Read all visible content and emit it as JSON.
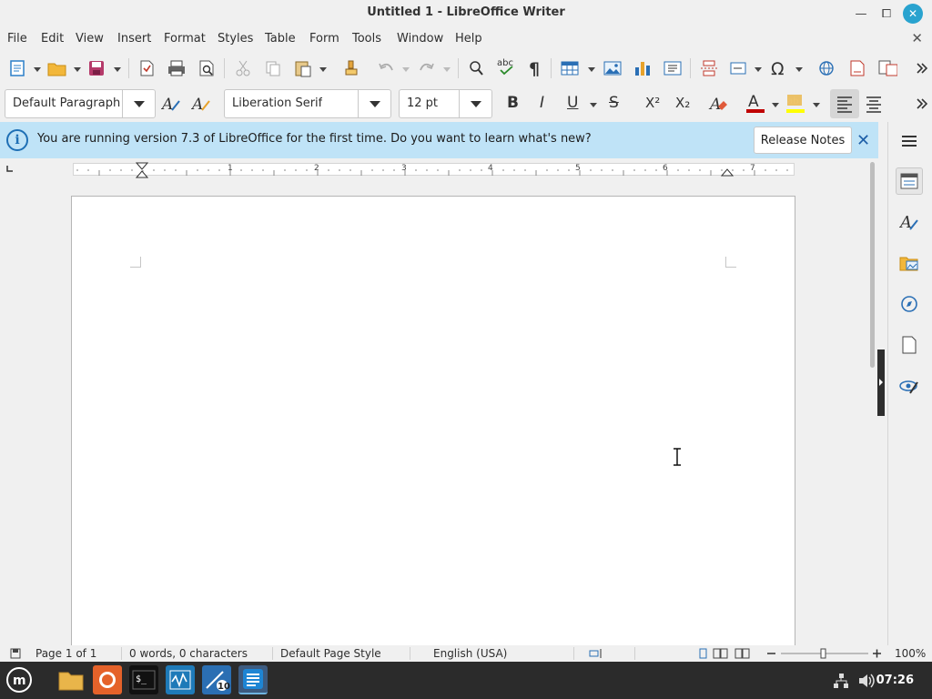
{
  "window": {
    "title": "Untitled 1 - LibreOffice Writer",
    "close_glyph": "✕",
    "maximize_glyph": "⧠",
    "minimize_glyph": "—"
  },
  "menubar": {
    "items": [
      "File",
      "Edit",
      "View",
      "Insert",
      "Format",
      "Styles",
      "Table",
      "Form",
      "Tools",
      "Window",
      "Help"
    ],
    "close_glyph": "✕"
  },
  "formatting": {
    "paragraph_style": "Default Paragraph",
    "font_name": "Liberation Serif",
    "font_size": "12 pt",
    "bold": "B",
    "italic": "I",
    "underline": "U",
    "strikethrough": "S",
    "superscript": "X²",
    "subscript": "X₂"
  },
  "infobar": {
    "message": "You are running version 7.3 of LibreOffice for the first time. Do you want to learn what's new?",
    "button": "Release Notes",
    "icon_glyph": "i",
    "close_glyph": "✕"
  },
  "ruler": {
    "numbers": [
      "1",
      "2",
      "3",
      "4",
      "5",
      "6",
      "7"
    ]
  },
  "statusbar": {
    "page": "Page 1 of 1",
    "words": "0 words, 0 characters",
    "page_style": "Default Page Style",
    "language": "English (USA)",
    "zoom": "100%"
  },
  "taskbar": {
    "time": "07:26"
  },
  "colors": {
    "accent": "#29a3cf",
    "infobar": "#bfe3f7",
    "taskbar": "#2b2b2b",
    "font_color_bar": "#c00000",
    "highlight_bar": "#ffff00"
  }
}
